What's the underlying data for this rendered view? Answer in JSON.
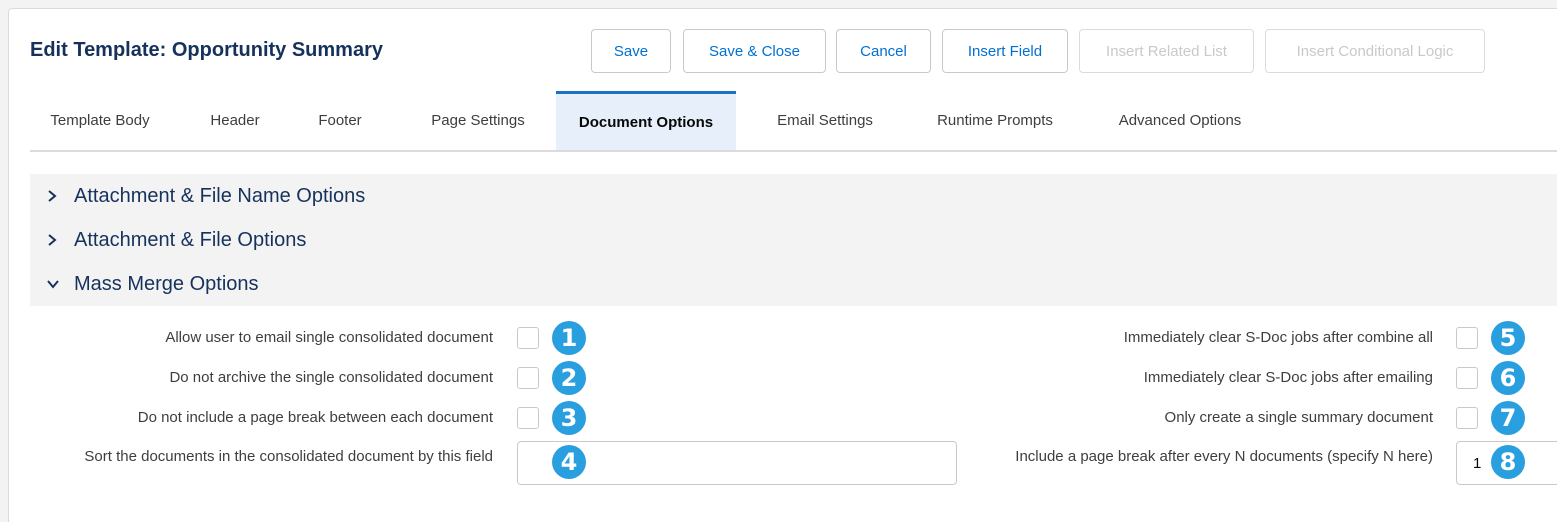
{
  "header": {
    "title": "Edit Template: Opportunity Summary",
    "buttons": {
      "save": "Save",
      "save_close": "Save & Close",
      "cancel": "Cancel",
      "insert_field": "Insert Field",
      "insert_related_list": "Insert Related List",
      "insert_conditional_logic": "Insert Conditional Logic"
    }
  },
  "tabs": [
    "Template Body",
    "Header",
    "Footer",
    "Page Settings",
    "Document Options",
    "Email Settings",
    "Runtime Prompts",
    "Advanced Options"
  ],
  "active_tab": "Document Options",
  "sections": [
    {
      "label": "Attachment & File Name Options",
      "expanded": false
    },
    {
      "label": "Attachment & File Options",
      "expanded": false
    },
    {
      "label": "Mass Merge Options",
      "expanded": true
    }
  ],
  "mass_merge": {
    "left": [
      {
        "label": "Allow user to email single consolidated document",
        "badge": "1",
        "checked": false
      },
      {
        "label": "Do not archive the single consolidated document",
        "badge": "2",
        "checked": false
      },
      {
        "label": "Do not include a page break between each document",
        "badge": "3",
        "checked": false
      },
      {
        "label": "Sort the documents in the consolidated document by this field",
        "badge": "4",
        "value": ""
      }
    ],
    "right": [
      {
        "label": "Immediately clear S-Doc jobs after combine all",
        "badge": "5",
        "checked": false
      },
      {
        "label": "Immediately clear S-Doc jobs after emailing",
        "badge": "6",
        "checked": false
      },
      {
        "label": "Only create a single summary document",
        "badge": "7",
        "checked": false
      },
      {
        "label": "Include a page break after every N documents (specify N here)",
        "badge": "8",
        "value": "1"
      }
    ]
  },
  "colors": {
    "title": "#16325c",
    "link": "#0070d2",
    "active_tab_border": "#1b72c4",
    "badge": "#2a9fe0"
  }
}
